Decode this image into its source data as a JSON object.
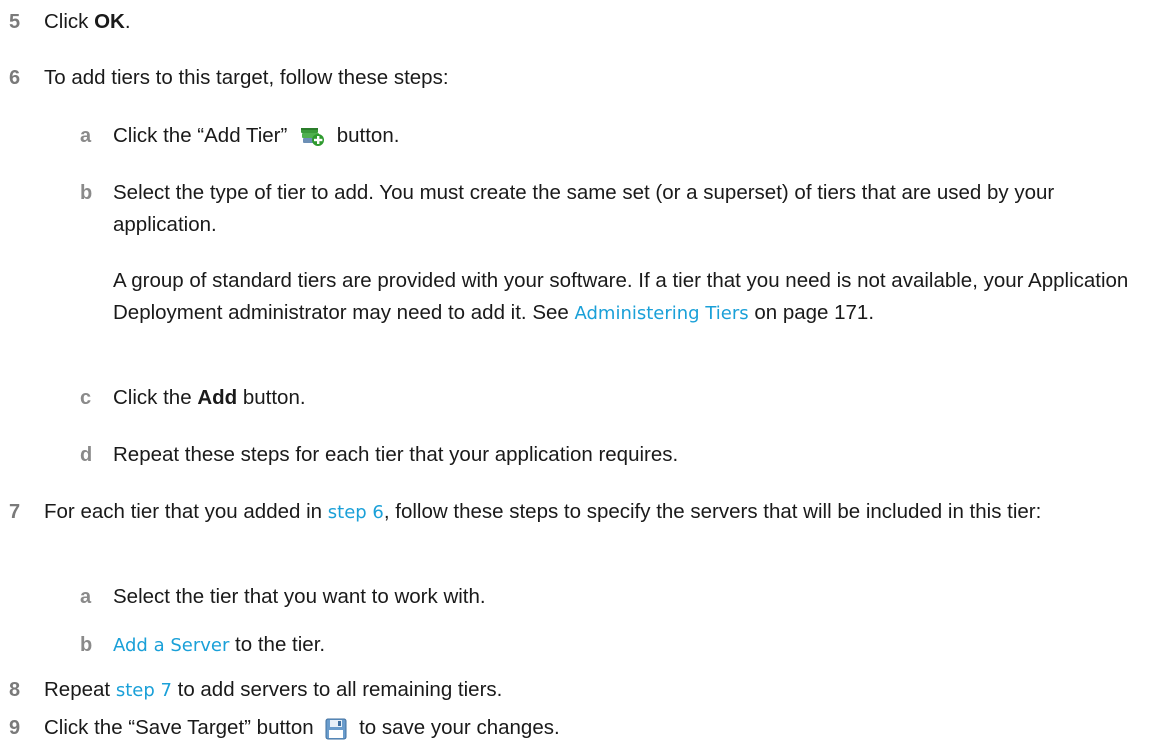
{
  "steps": {
    "s5": {
      "num": "5",
      "pre": "Click ",
      "bold": "OK",
      "post": "."
    },
    "s6": {
      "num": "6",
      "text": "To add tiers to this target, follow these steps:",
      "a": {
        "num": "a",
        "pre": "Click the “Add Tier”",
        "icon": "add-tier-icon",
        "post": "button."
      },
      "b": {
        "num": "b",
        "text": "Select the type of tier to add. You must create the same set (or a superset) of tiers that are used by your application.",
        "para_pre": "A group of standard tiers are provided with your software. If a tier that you need is not available, your Application Deployment administrator may need to add it. See ",
        "para_link": "Administering Tiers",
        "para_post": " on page 171."
      },
      "c": {
        "num": "c",
        "pre": "Click the ",
        "bold": "Add",
        "post": " button."
      },
      "d": {
        "num": "d",
        "text": "Repeat these steps for each tier that your application requires."
      }
    },
    "s7": {
      "num": "7",
      "pre": "For each tier that you added in ",
      "link": "step 6",
      "post": ", follow these steps to specify the servers that will be included in this tier:",
      "a": {
        "num": "a",
        "text": "Select the tier that you want to work with."
      },
      "b": {
        "num": "b",
        "link": "Add a Server",
        "post": " to the tier."
      }
    },
    "s8": {
      "num": "8",
      "pre": "Repeat ",
      "link": "step 7",
      "post": " to add servers to all remaining tiers."
    },
    "s9": {
      "num": "9",
      "pre": "Click the “Save Target” button",
      "icon": "save-icon",
      "post": "to save your changes."
    }
  },
  "colors": {
    "link": "#1aa0d8",
    "step_number": "#7a7a7a",
    "text": "#1a1a1a"
  }
}
